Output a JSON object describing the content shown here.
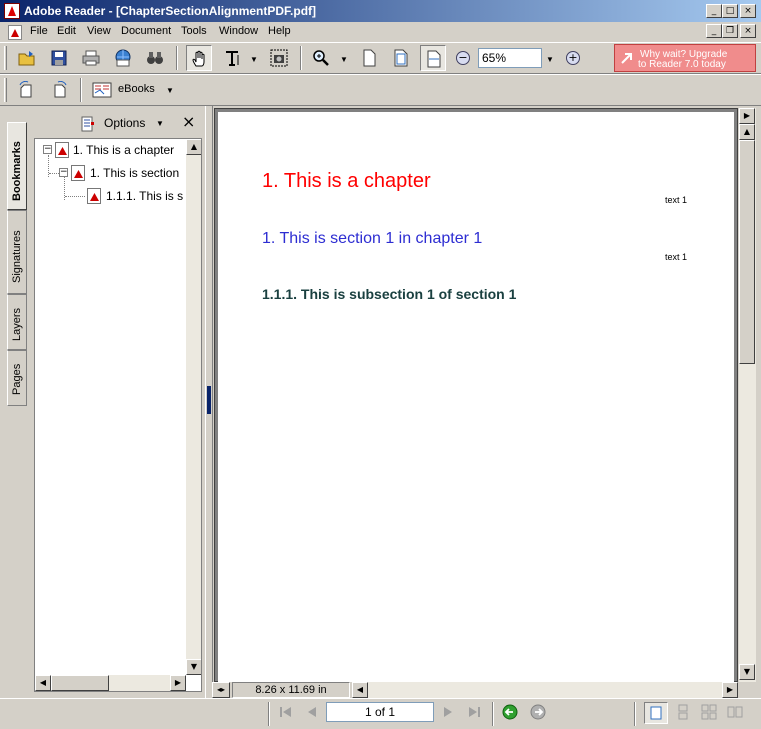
{
  "window": {
    "title": "Adobe Reader - [ChapterSectionAlignmentPDF.pdf]",
    "controls": {
      "minimize": "_",
      "maximize": "□",
      "close": "×"
    }
  },
  "menubar": {
    "items": [
      "File",
      "Edit",
      "View",
      "Document",
      "Tools",
      "Window",
      "Help"
    ]
  },
  "toolbar": {
    "zoom_value": "65%",
    "ebooks_label": "eBooks",
    "upgrade_line1": "Why wait? Upgrade",
    "upgrade_line2": "to Reader 7.0 today"
  },
  "sidetabs": [
    "Bookmarks",
    "Signatures",
    "Layers",
    "Pages"
  ],
  "bookmarks": {
    "options_label": "Options",
    "close_label": "×",
    "items": [
      "1. This is a chapter",
      "1. This is section",
      "1.1.1. This is s"
    ]
  },
  "document": {
    "chapter": "1. This is a chapter",
    "text1": "text 1",
    "section": "1. This is section 1 in chapter 1",
    "text2": "text 1",
    "subsection": "1.1.1. This is subsection 1 of section 1"
  },
  "status": {
    "page_size": "8.26 x 11.69 in",
    "page_indicator": "1 of 1"
  },
  "colors": {
    "chapter": "#ff0000",
    "section": "#2d2dd2",
    "subsection": "#1a4040",
    "upgrade_bg": "#f08c8c"
  }
}
